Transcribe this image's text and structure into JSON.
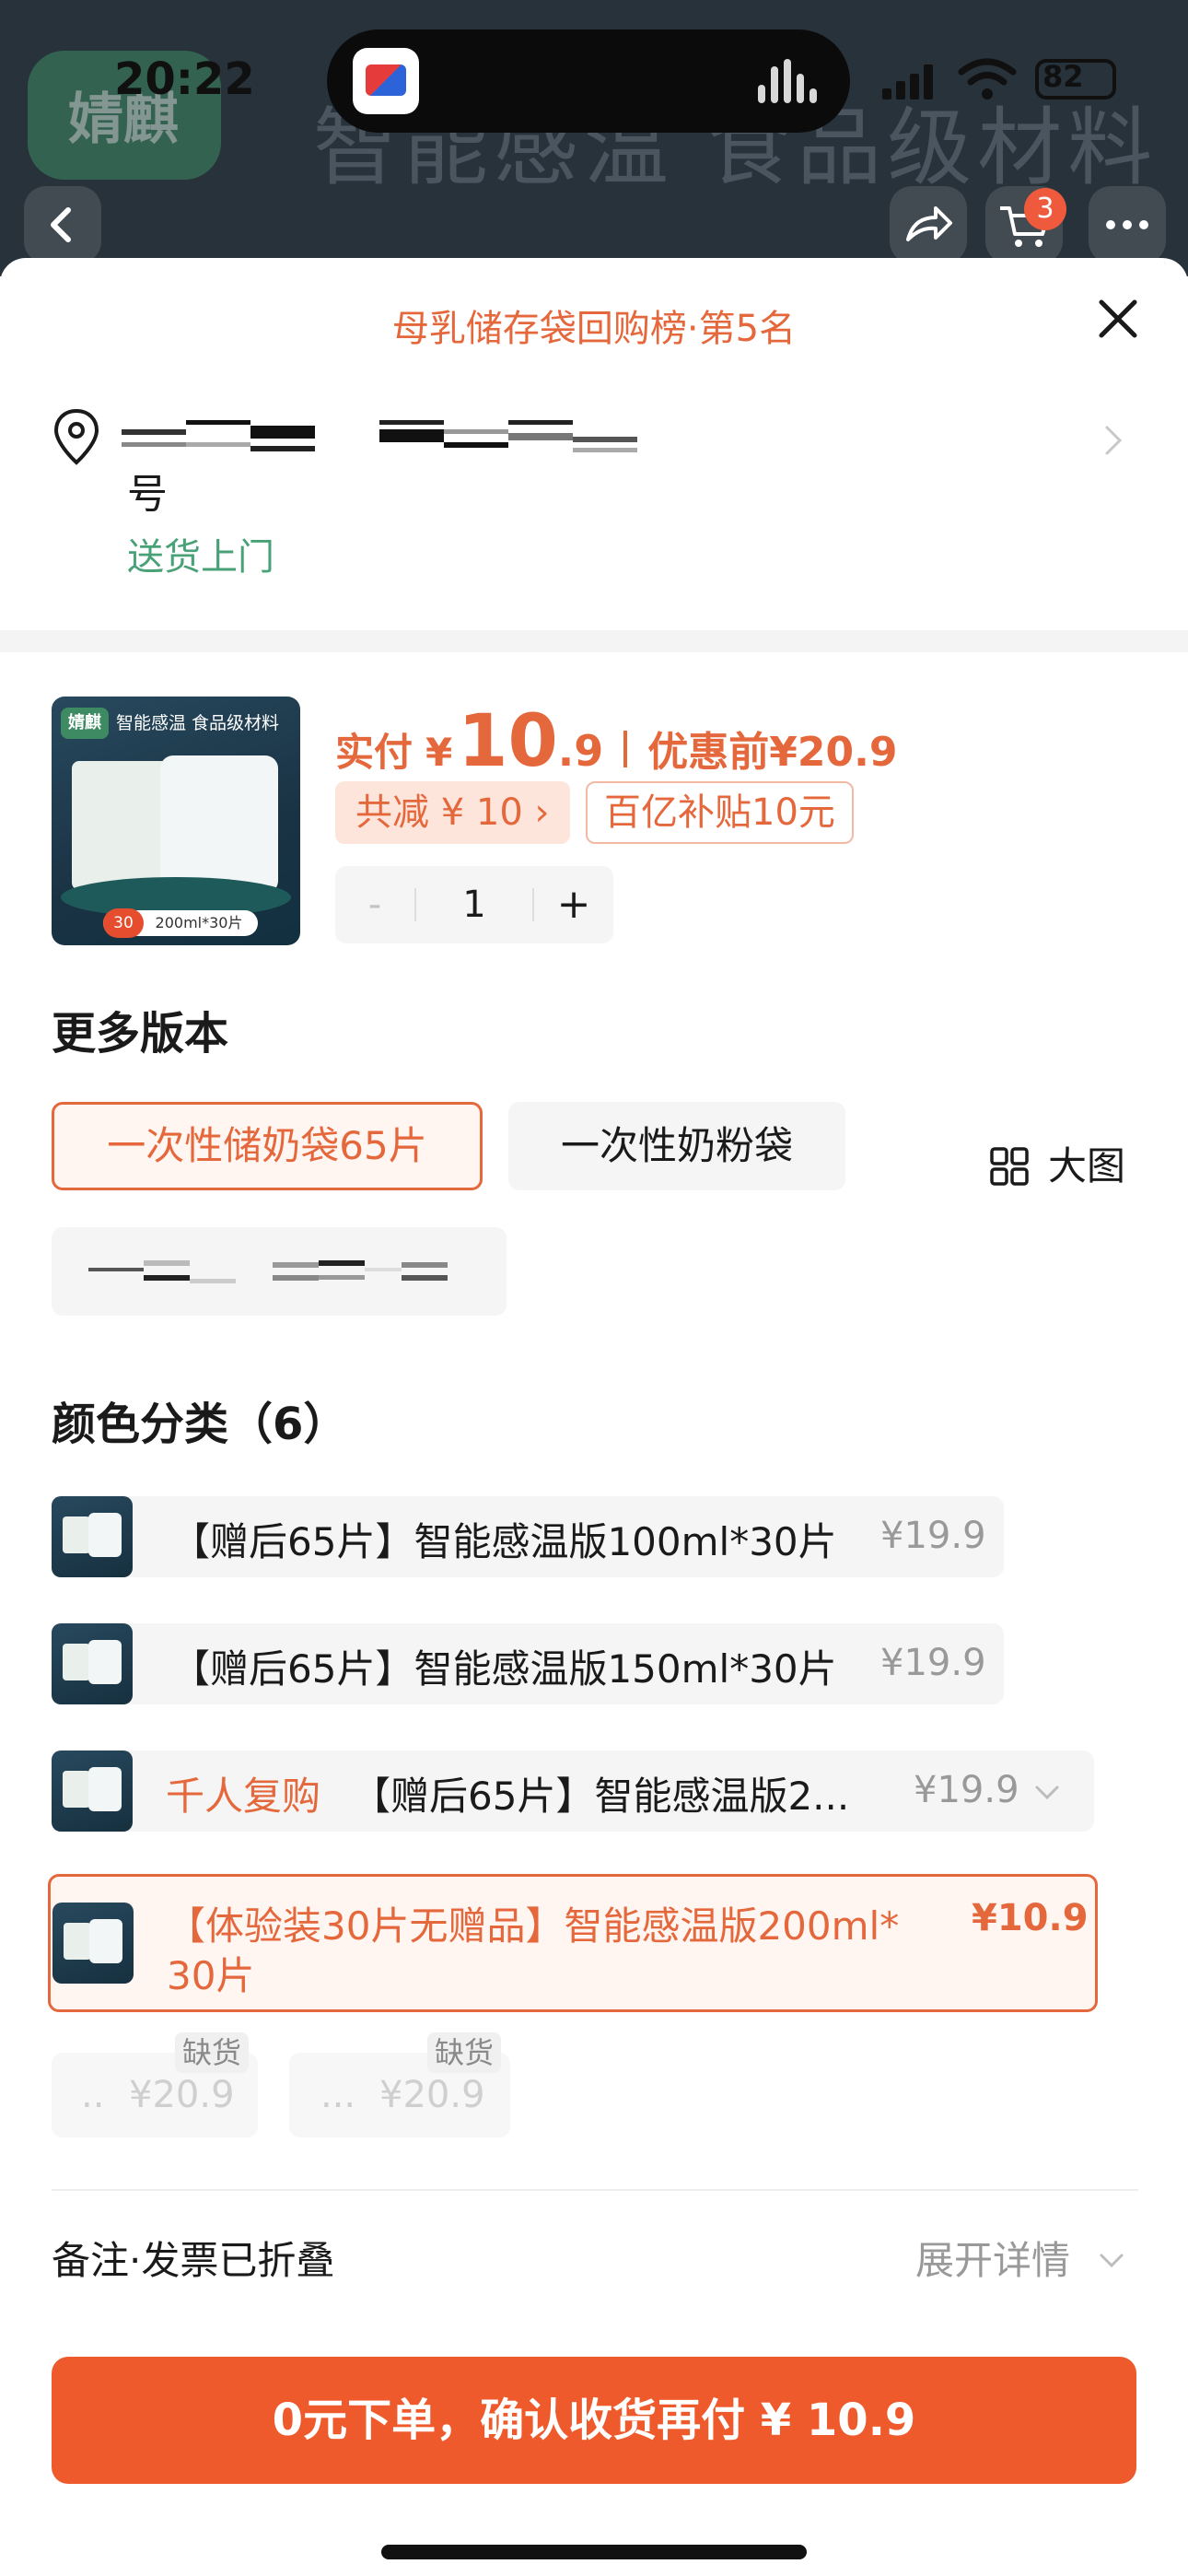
{
  "status_bar": {
    "time": "20:22",
    "battery": "82"
  },
  "background_page": {
    "brand": "婧麒",
    "slogan": "智能感温 食品级材料",
    "cart_count": "3"
  },
  "sheet": {
    "rank_title": "母乳储存袋回购榜·第5名",
    "address": {
      "tail": "号",
      "delivery": "送货上门"
    },
    "product": {
      "image_brand": "婧麒",
      "image_tagline": "智能感温 食品级材料",
      "image_badge": "30",
      "image_spec": "200ml*30片",
      "price_label": "实付",
      "currency": "¥",
      "price_int": "10",
      "price_dec": ".9",
      "before_label": "优惠前",
      "before_price": "¥20.9",
      "discount": "共减 ¥ 10 ›",
      "subsidy": "百亿补贴10元",
      "quantity": "1",
      "minus": "-",
      "plus": "+"
    },
    "versions": {
      "title": "更多版本",
      "items": [
        {
          "label": "一次性储奶袋65片",
          "selected": true
        },
        {
          "label": "一次性奶粉袋",
          "selected": false
        }
      ]
    },
    "colors": {
      "title": "颜色分类（6）",
      "big_view": "大图",
      "options": [
        {
          "label": "【赠后65片】智能感温版100ml*30片",
          "price": "¥19.9"
        },
        {
          "label": "【赠后65片】智能感温版150ml*30片",
          "price": "¥19.9"
        },
        {
          "hot": "千人复购",
          "label": "【赠后65片】智能感温版2...",
          "price": "¥19.9"
        },
        {
          "label": "【体验装30片无赠品】智能感温版200ml*",
          "label2": "30片",
          "price": "¥10.9",
          "selected": true
        }
      ],
      "out_of_stock": [
        {
          "ellipsis": "..",
          "price": "¥20.9",
          "tag": "缺货"
        },
        {
          "ellipsis": "...",
          "price": "¥20.9",
          "tag": "缺货"
        }
      ]
    },
    "remark": {
      "label": "备注·发票已折叠",
      "expand": "展开详情"
    },
    "cta": "0元下单，确认收货再付 ¥ 10.9"
  },
  "colors": {
    "accent": "#e5683c",
    "cta": "#ef5a2c",
    "delivery_green": "#49a277"
  }
}
